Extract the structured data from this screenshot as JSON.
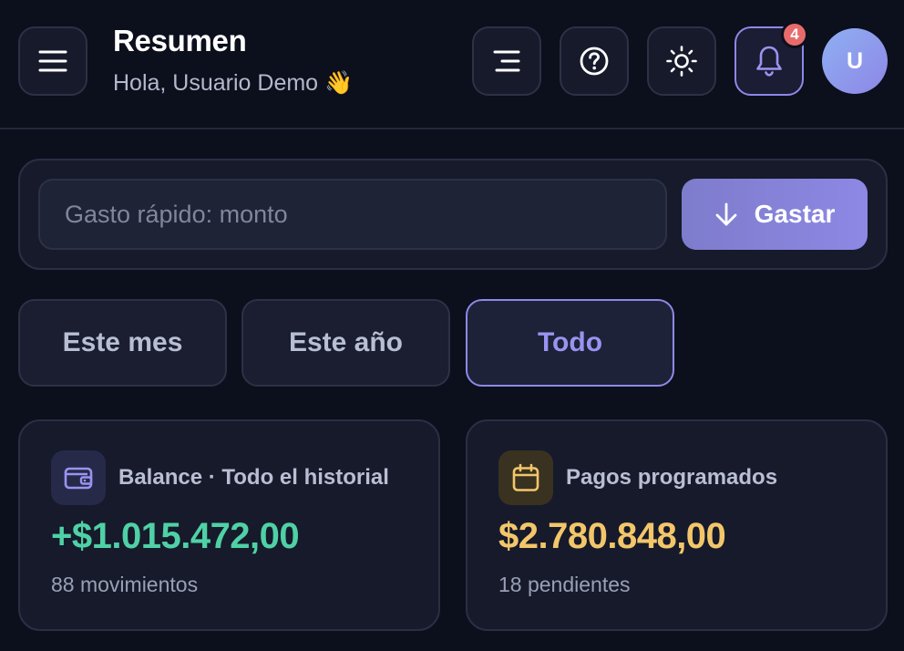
{
  "header": {
    "title": "Resumen",
    "greeting": "Hola, Usuario Demo 👋",
    "notification_count": "4",
    "avatar_initial": "U"
  },
  "quick_spend": {
    "placeholder": "Gasto rápido: monto",
    "value": "",
    "button_label": "Gastar"
  },
  "periods": [
    {
      "label": "Este mes",
      "active": false
    },
    {
      "label": "Este año",
      "active": false
    },
    {
      "label": "Todo",
      "active": true
    }
  ],
  "cards": {
    "balance": {
      "label": "Balance · Todo el historial",
      "amount": "+$1.015.472,00",
      "subtext": "88 movimientos",
      "icon": "wallet-icon"
    },
    "scheduled": {
      "label": "Pagos programados",
      "amount": "$2.780.848,00",
      "subtext": "18 pendientes",
      "icon": "calendar-icon"
    }
  },
  "colors": {
    "background": "#0c0f1c",
    "accent": "#8e88e6",
    "positive": "#4fd1a5",
    "warning": "#f3c66a",
    "badge": "#e86b6b"
  }
}
